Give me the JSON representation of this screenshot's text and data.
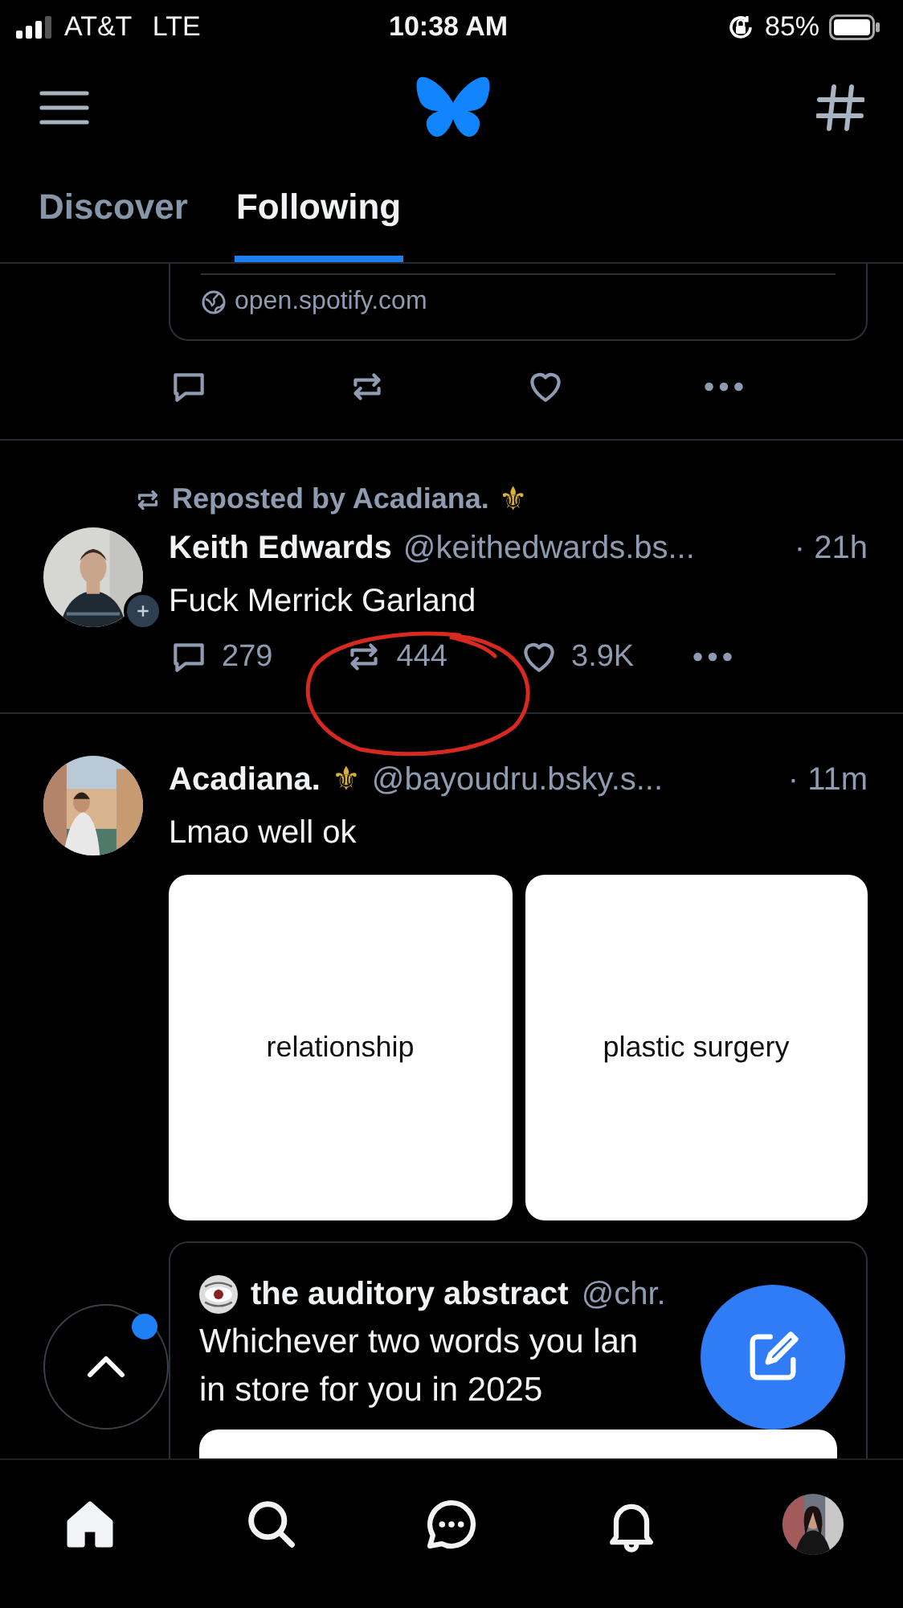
{
  "status_bar": {
    "carrier": "AT&T",
    "network": "LTE",
    "time": "10:38 AM",
    "battery": "85%"
  },
  "tabs": [
    {
      "label": "Discover",
      "selected": false
    },
    {
      "label": "Following",
      "selected": true
    }
  ],
  "feed": [
    {
      "kind": "partial",
      "link_domain": "open.spotify.com",
      "actions": [
        {
          "kind": "reply"
        },
        {
          "kind": "repost"
        },
        {
          "kind": "like"
        },
        {
          "kind": "more"
        }
      ]
    },
    {
      "kind": "post",
      "reposted_by": "Reposted by Acadiana.",
      "reposted_by_badge": "⚜",
      "author": "Keith Edwards",
      "handle": "@keithedwards.bs...",
      "time": "· 21h",
      "text": "Fuck Merrick Garland",
      "follow_badge": true,
      "actions": [
        {
          "kind": "reply",
          "count": "279"
        },
        {
          "kind": "repost",
          "count": "444"
        },
        {
          "kind": "like",
          "count": "3.9K"
        },
        {
          "kind": "more"
        }
      ]
    },
    {
      "kind": "post",
      "author": "Acadiana.",
      "author_badge": "⚜",
      "handle": "@bayoudru.bsky.s...",
      "time": "· 11m",
      "text": "Lmao well ok",
      "images": [
        {
          "caption": "relationship"
        },
        {
          "caption": "plastic surgery"
        }
      ],
      "quote": {
        "author": "the auditory abstract",
        "handle": "@chr.",
        "lines": [
          "Whichever two words you lan",
          "in store for you in 2025"
        ]
      }
    }
  ],
  "scroll_top": {
    "unread": true
  },
  "nav": [
    {
      "kind": "home",
      "selected": true
    },
    {
      "kind": "search",
      "selected": false
    },
    {
      "kind": "chat",
      "selected": false
    },
    {
      "kind": "notifications",
      "selected": false
    },
    {
      "kind": "profile",
      "selected": false
    }
  ]
}
